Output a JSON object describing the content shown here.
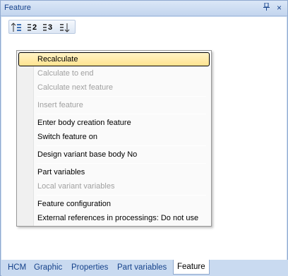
{
  "window": {
    "title": "Feature"
  },
  "toolbar": {
    "buttons": [
      {
        "icon": "sort-feature-icon",
        "label": ""
      },
      {
        "icon": "list-2-icon",
        "label": "2"
      },
      {
        "icon": "list-3-icon",
        "label": "3"
      },
      {
        "icon": "sort-down-icon",
        "label": ""
      }
    ]
  },
  "menu": {
    "items": [
      {
        "label": "Recalculate",
        "enabled": true,
        "highlighted": true
      },
      {
        "label": "Calculate to end",
        "enabled": false
      },
      {
        "label": "Calculate next feature",
        "enabled": false
      },
      {
        "label": "Insert feature",
        "enabled": false
      },
      {
        "label": "Enter body creation feature",
        "enabled": true
      },
      {
        "label": "Switch feature on",
        "enabled": true
      },
      {
        "label": "Design variant base body No",
        "enabled": true
      },
      {
        "label": "Part variables",
        "enabled": true
      },
      {
        "label": "Local variant variables",
        "enabled": false
      },
      {
        "label": "Feature configuration",
        "enabled": true
      },
      {
        "label": "External references in processings: Do not use",
        "enabled": true
      }
    ]
  },
  "tabs": [
    {
      "label": "HCM",
      "active": false
    },
    {
      "label": "Graphic",
      "active": false
    },
    {
      "label": "Properties",
      "active": false
    },
    {
      "label": "Part variables",
      "active": false
    },
    {
      "label": "Feature",
      "active": true
    }
  ],
  "colors": {
    "title_text": "#15428b",
    "highlight_top": "#fff3c6",
    "highlight_bottom": "#ffe38f",
    "disabled_text": "#a0a0a0"
  }
}
